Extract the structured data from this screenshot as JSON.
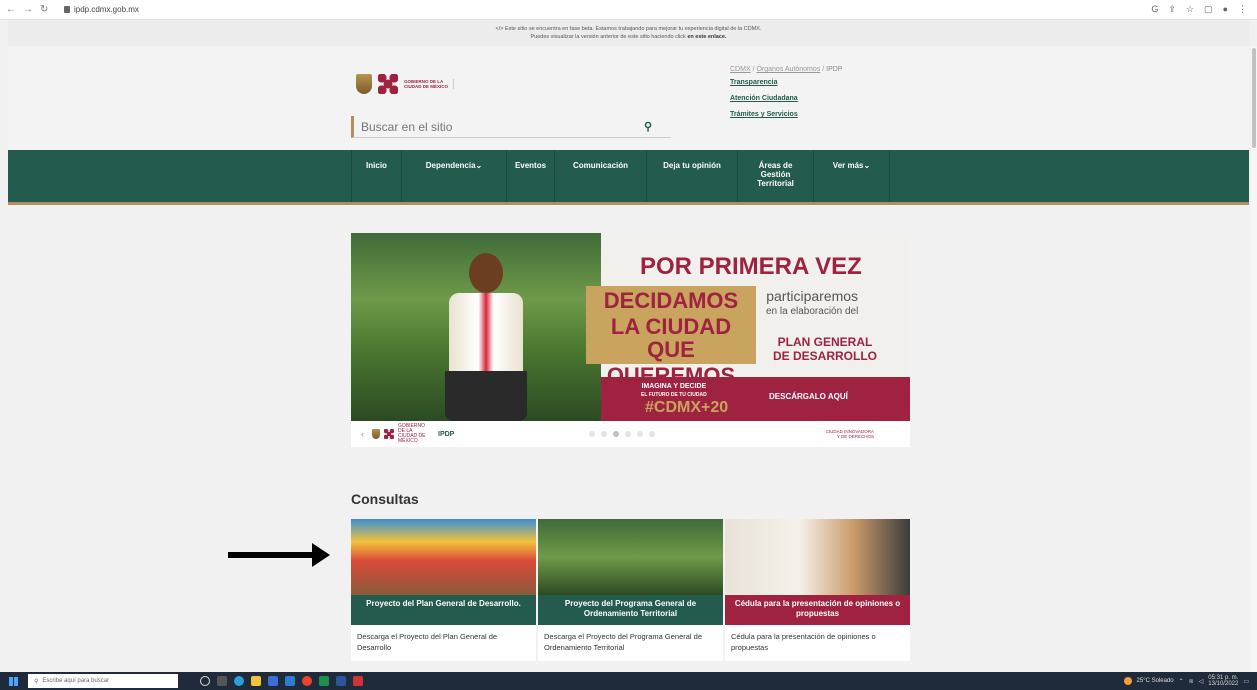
{
  "browser": {
    "url": "ipdp.cdmx.gob.mx",
    "nav_icons": [
      "back-icon",
      "forward-icon",
      "reload-icon"
    ],
    "right_icons": [
      "google-icon",
      "share-icon",
      "star-icon",
      "sidepanel-icon",
      "profile-icon",
      "menu-icon"
    ]
  },
  "beta_notice": {
    "line1": "</> Este sitio se encuentra en fase beta. Estamos trabajando para mejorar tu experiencia digital de la CDMX.",
    "line2": "Puedes visualizar la versión anterior de este sitio haciendo click",
    "link": "en este enlace."
  },
  "header": {
    "logo_text_1": "GOBIERNO DE LA",
    "logo_text_2": "CIUDAD DE MÉXICO",
    "search_placeholder": "Buscar en el sitio",
    "breadcrumb": [
      "CDMX",
      "Órganos Autónomos",
      "IPDP"
    ],
    "links": [
      "Transparencia",
      "Atención Ciudadana",
      "Trámites y Servicios"
    ]
  },
  "nav": {
    "items": [
      {
        "label": "Inicio",
        "width": 50
      },
      {
        "label": "Dependencia",
        "width": 105,
        "chevron": true
      },
      {
        "label": "Eventos",
        "width": 48
      },
      {
        "label": "Comunicación",
        "width": 92
      },
      {
        "label": "Deja tu opinión",
        "width": 91
      },
      {
        "label": "Áreas de\nGestión\nTerritorial",
        "width": 76
      },
      {
        "label": "Ver más",
        "width": 76,
        "chevron": true
      }
    ]
  },
  "banner": {
    "title": "POR PRIMERA VEZ",
    "block_lines": [
      "DECIDAMOS",
      "LA CIUDAD QUE",
      "QUEREMOS"
    ],
    "participaremos": "participaremos",
    "en_la": "en la elaboración del",
    "plan_lines": [
      "PLAN GENERAL",
      "DE DESARROLLO"
    ],
    "imagina_1": "IMAGINA Y DECIDE",
    "imagina_2": "EL FUTURO DE TU CIUDAD",
    "hashtag": "#CDMX+20",
    "cta": "DESCÁRGALO AQUÍ",
    "foot_logo": "GOBIERNO DE LA CIUDAD DE MÉXICO",
    "foot_ipdp": "IPDP",
    "foot_right_1": "CIUDAD INNOVADORA",
    "foot_right_2": "Y DE DERECHOS",
    "dots": 6,
    "active_dot": 2
  },
  "consultas": {
    "title": "Consultas",
    "cards": [
      {
        "caption": "Proyecto del Plan General de Desarrollo.",
        "caption_color": "#235b4e",
        "desc": "Descarga el Proyecto del Plan General de Desarrollo"
      },
      {
        "caption": "Proyecto del Programa General de Ordenamiento Territorial",
        "caption_color": "#235b4e",
        "desc": "Descarga el Proyecto del Programa General de Ordenamiento Territorial"
      },
      {
        "caption": "Cédula para la presentación de opiniones o propuestas",
        "caption_color": "#9f2241",
        "desc": "Cédula para la presentación de opiniones o propuestas"
      }
    ]
  },
  "taskbar": {
    "search": "Escribe aquí para buscar",
    "weather": "25°C Soleado",
    "time": "05:31 p. m.",
    "date": "13/10/2022"
  },
  "colors": {
    "primary_green": "#235b4e",
    "wine": "#9f2241",
    "gold": "#b38e5d"
  }
}
